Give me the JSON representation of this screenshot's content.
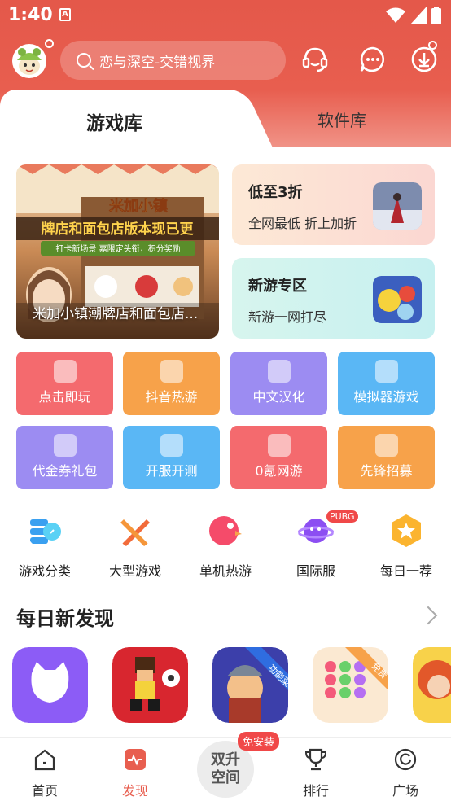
{
  "status_bar": {
    "time": "1:40",
    "notification_glyph": "A"
  },
  "header": {
    "search_placeholder": "恋与深空-交错视界",
    "icons": [
      "avatar",
      "support-headset-icon",
      "chat-bubble-icon",
      "download-icon"
    ]
  },
  "tabs": [
    {
      "label": "游戏库",
      "selected": true
    },
    {
      "label": "软件库",
      "selected": false
    }
  ],
  "banner": {
    "caption": "米加小镇潮牌店和面包店...",
    "art_title_top": "米加小镇",
    "art_title": "牌店和面包店版本现已更",
    "art_subtitle": "打卡新场景 嘉限定头衔，积分奖励"
  },
  "promos": [
    {
      "title": "低至3折",
      "subtitle": "全网最低 折上加折"
    },
    {
      "title": "新游专区",
      "subtitle": "新游一网打尽"
    }
  ],
  "features": [
    {
      "label": "点击即玩",
      "color": "#f46a6e"
    },
    {
      "label": "抖音热游",
      "color": "#f7a24a"
    },
    {
      "label": "中文汉化",
      "color": "#9c8cf2"
    },
    {
      "label": "模拟器游戏",
      "color": "#5ab7f5"
    },
    {
      "label": "代金券礼包",
      "color": "#9c8cf2"
    },
    {
      "label": "开服开测",
      "color": "#5ab7f5"
    },
    {
      "label": "0氪网游",
      "color": "#f46a6e"
    },
    {
      "label": "先锋招募",
      "color": "#f7a24a"
    }
  ],
  "categories": [
    {
      "label": "游戏分类"
    },
    {
      "label": "大型游戏"
    },
    {
      "label": "单机热游"
    },
    {
      "label": "国际服",
      "badge": "PUBG"
    },
    {
      "label": "每日一荐"
    }
  ],
  "section": {
    "title": "每日新发现"
  },
  "apps": [
    {
      "overlay": ""
    },
    {
      "overlay": ""
    },
    {
      "overlay": "功能菜单"
    },
    {
      "overlay": "免费"
    },
    {
      "overlay": ""
    }
  ],
  "bottom_nav": {
    "items": [
      {
        "label": "首页"
      },
      {
        "label": "发现",
        "active": true
      },
      {
        "label": "排行"
      },
      {
        "label": "广场"
      }
    ],
    "center": {
      "line1": "双升",
      "line2": "空间",
      "badge": "免安装"
    }
  },
  "colors": {
    "brand": "#e85e4f",
    "accent_red": "#f04848"
  }
}
